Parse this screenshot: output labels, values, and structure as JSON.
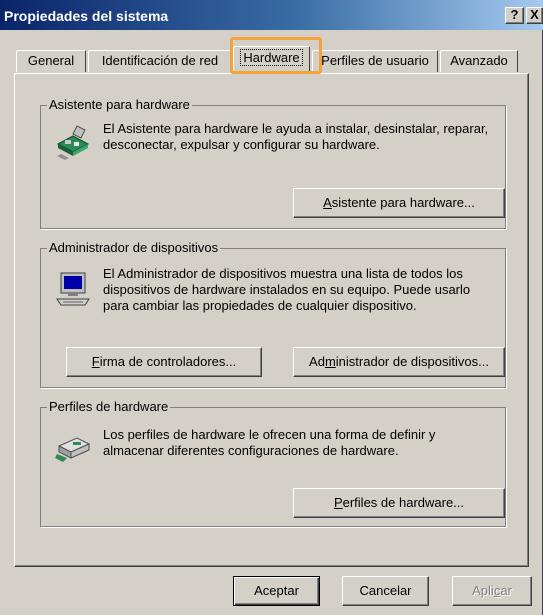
{
  "window": {
    "title": "Propiedades del sistema",
    "help_label": "?",
    "close_label": "X"
  },
  "tabs": [
    {
      "label": "General"
    },
    {
      "label": "Identificación de red"
    },
    {
      "label": "Hardware",
      "active": true
    },
    {
      "label": "Perfiles de usuario"
    },
    {
      "label": "Avanzado"
    }
  ],
  "sections": {
    "wizard": {
      "legend": "Asistente para hardware",
      "description": "El Asistente para hardware le ayuda a instalar, desinstalar, reparar, desconectar, expulsar y configurar su hardware.",
      "button_accel": "A",
      "button_rest": "sistente para hardware...",
      "icon": "hardware-wizard-icon"
    },
    "device_manager": {
      "legend": "Administrador de dispositivos",
      "description": "El Administrador de dispositivos muestra una lista de todos los dispositivos de hardware instalados en su equipo. Puede usarlo para cambiar las propiedades de cualquier dispositivo.",
      "signing_accel": "F",
      "signing_rest": "irma de controladores...",
      "manager_pre": "Ad",
      "manager_accel": "m",
      "manager_rest": "inistrador de dispositivos...",
      "icon": "computer-icon"
    },
    "profiles": {
      "legend": "Perfiles de hardware",
      "description": "Los perfiles de hardware le ofrecen una forma de definir y almacenar diferentes configuraciones de hardware.",
      "button_accel": "P",
      "button_rest": "erfiles de hardware...",
      "icon": "hardware-profile-icon"
    }
  },
  "footer": {
    "ok_label": "Aceptar",
    "cancel_label": "Cancelar",
    "apply_pre": "Apli",
    "apply_accel": "c",
    "apply_rest": "ar"
  },
  "colors": {
    "face": "#d4d0c8",
    "titlebar_start": "#0a246a",
    "titlebar_end": "#a6caf0",
    "highlight": "#f4a23c"
  }
}
